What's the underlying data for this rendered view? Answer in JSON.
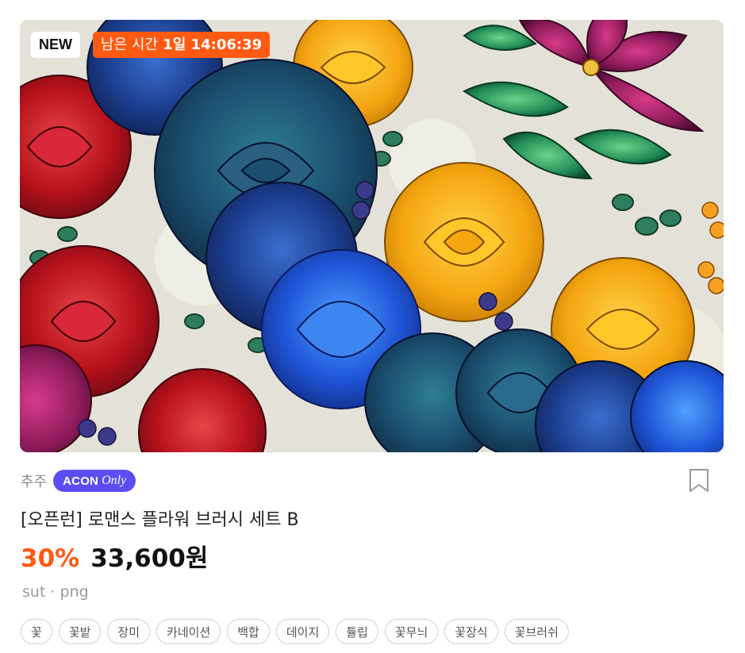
{
  "thumbnail": {
    "alt": "flower brush illustration"
  },
  "badges": {
    "new": "NEW",
    "timer_label": "남은 시간",
    "timer_value": "1일 14:06:39"
  },
  "author": "추주",
  "acon_badge": {
    "acon": "ACON",
    "only": "Only"
  },
  "product_title": "[오픈런] 로맨스 플라워 브러시 세트 B",
  "discount": "30%",
  "price": "33,600원",
  "formats": "sut · png",
  "tags": [
    "꽃",
    "꽃밭",
    "장미",
    "카네이션",
    "백합",
    "데이지",
    "튤립",
    "꽃무늬",
    "꽃장식",
    "꽃브러쉬"
  ],
  "colors": {
    "accent": "#ff5a13",
    "acon_purple": "#5b4df2"
  },
  "icons": {
    "bookmark": "bookmark-icon"
  }
}
